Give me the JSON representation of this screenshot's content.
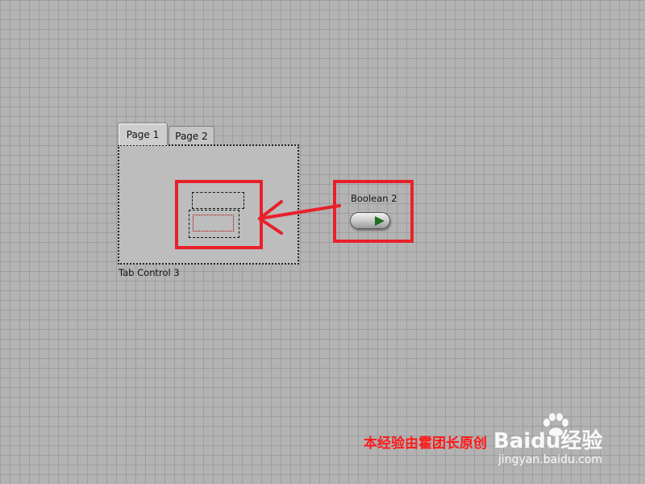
{
  "tab_control": {
    "tabs": [
      {
        "label": "Page 1",
        "active": true
      },
      {
        "label": "Page 2",
        "active": false
      }
    ],
    "label": "Tab Control 3"
  },
  "boolean_control": {
    "label": "Boolean 2",
    "state": "on"
  },
  "annotation": {
    "color": "#e8202a"
  },
  "watermark": {
    "caption": "本经验由霍团长原创",
    "brand": "Baidu经验",
    "url": "jingyan.baidu.com"
  }
}
